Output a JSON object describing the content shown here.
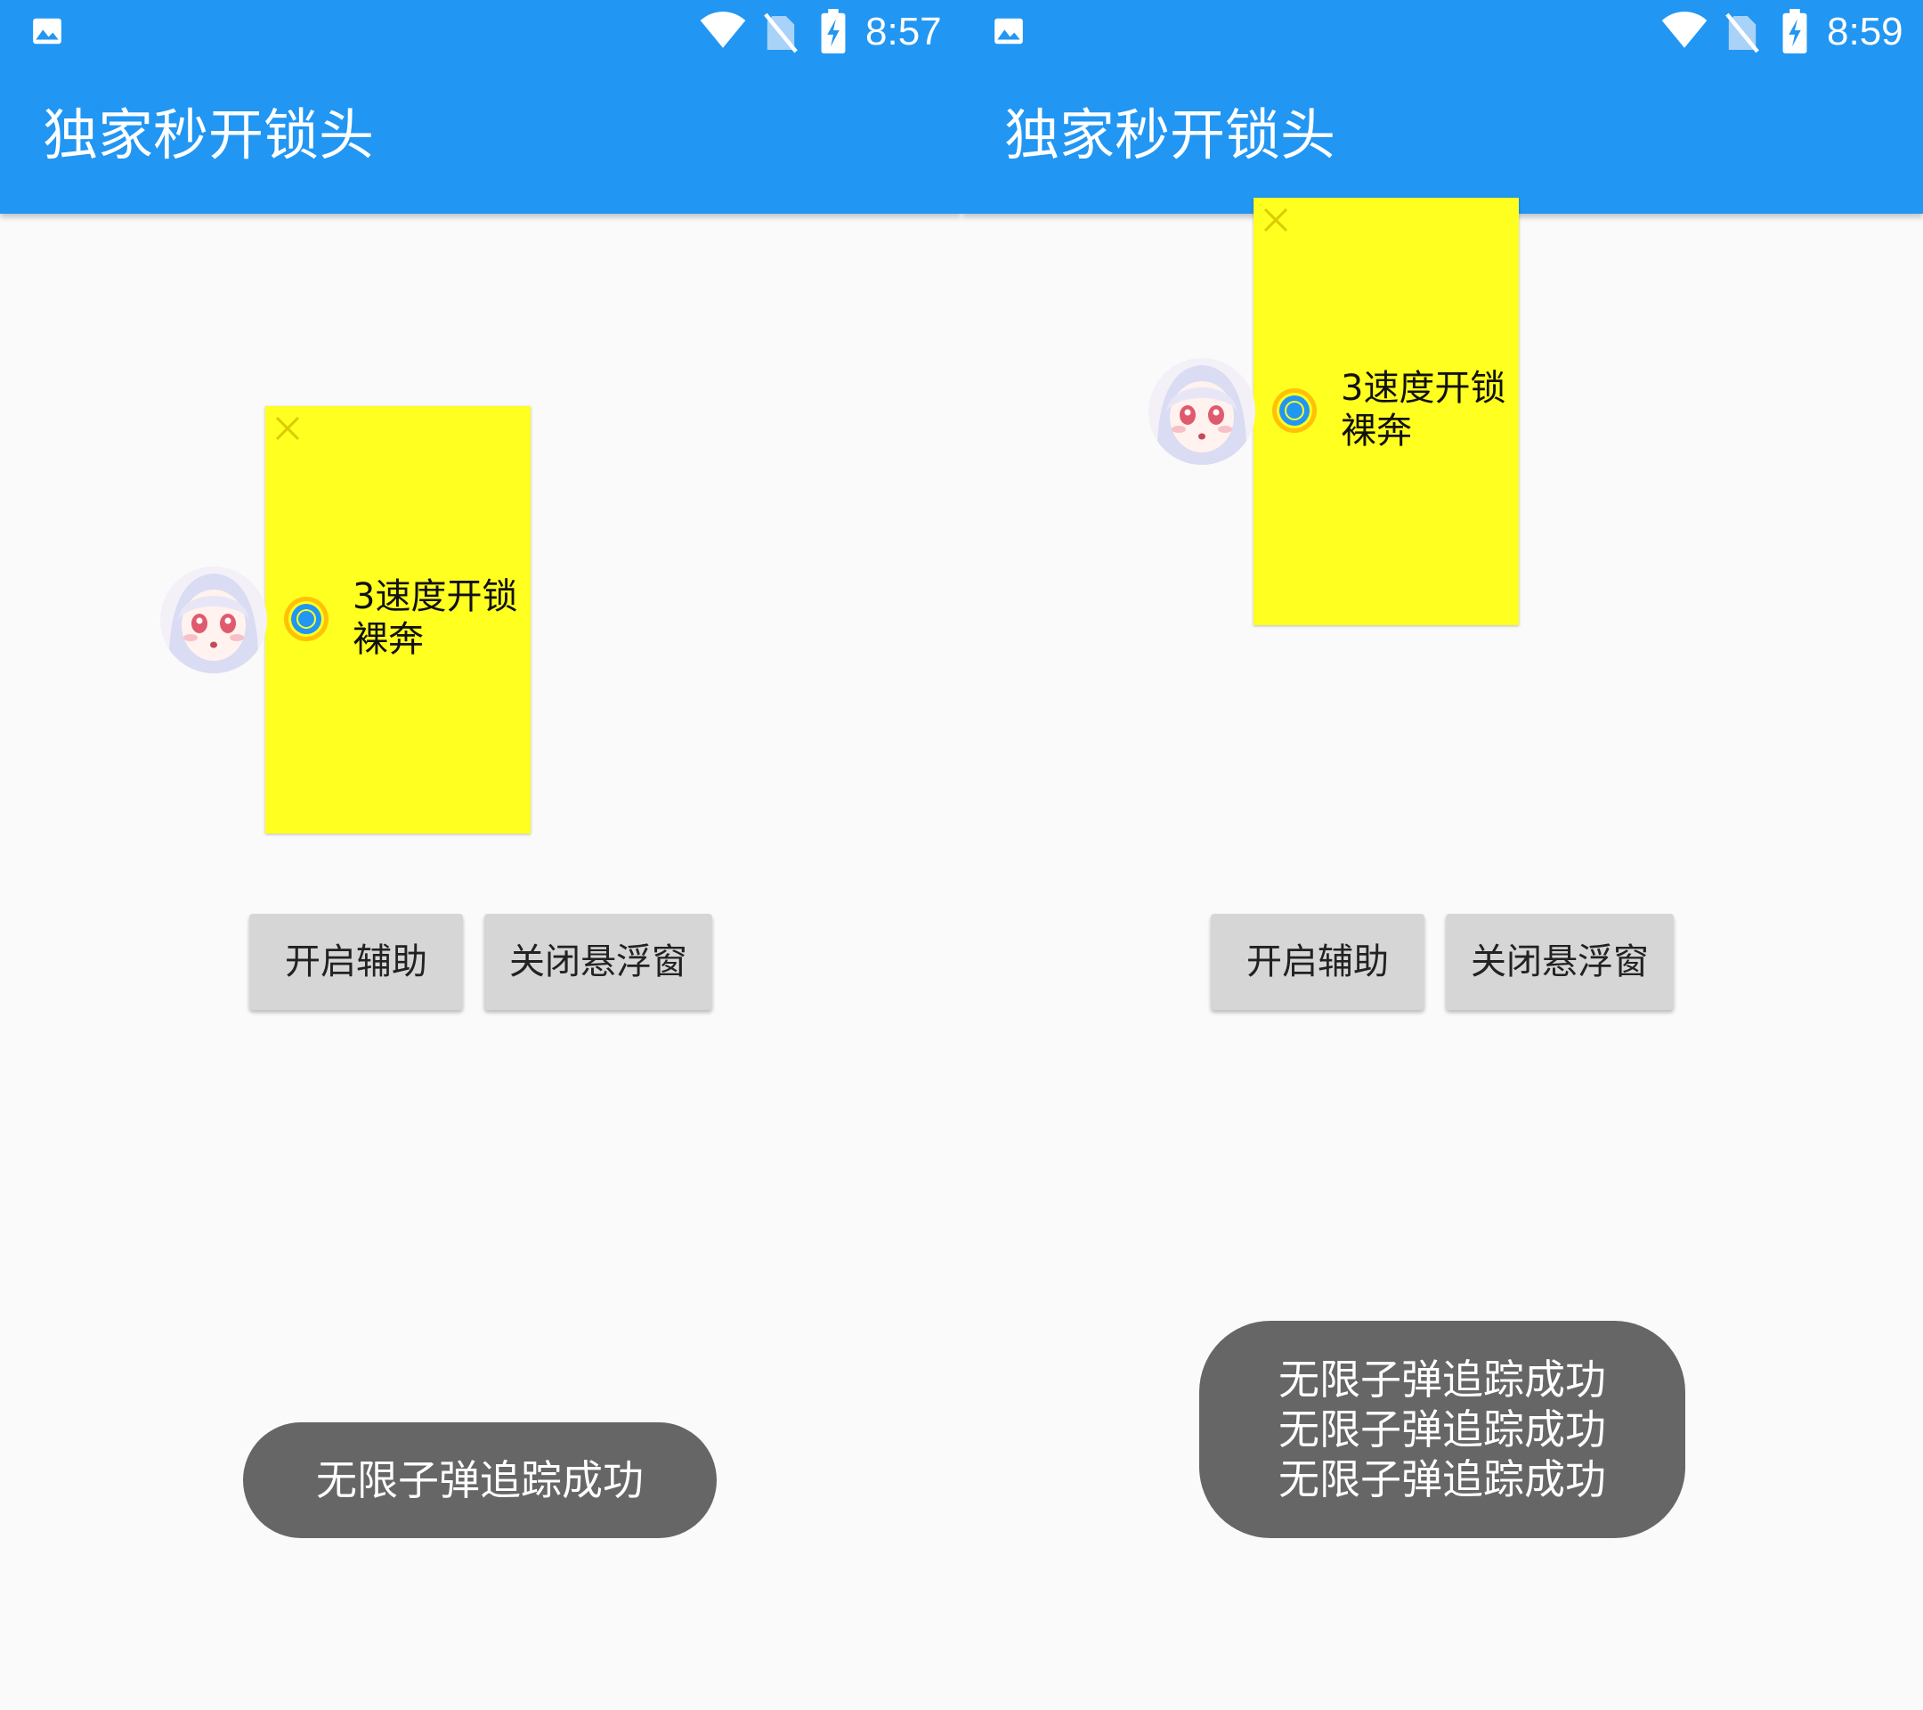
{
  "colors": {
    "app_bar": "#2196f3",
    "background": "#fafafa",
    "floating_panel": "#ffff20",
    "radio_accent": "#2196f3",
    "radio_ring": "#ffc107",
    "button": "#d6d6d6",
    "toast": "#666666"
  },
  "left": {
    "status": {
      "time": "8:57",
      "icons": [
        "gallery-icon",
        "wifi-icon",
        "no-sim-icon",
        "battery-charging-icon"
      ]
    },
    "app_title": "独家秒开锁头",
    "floating_window": {
      "close_icon": "close-icon",
      "radio_icon": "radio-selected-icon",
      "option_label": "3速度开锁\n裸奔"
    },
    "buttons": {
      "open_assist": "开启辅助",
      "close_float": "关闭悬浮窗"
    },
    "toast": [
      "无限子弹追踪成功"
    ]
  },
  "right": {
    "status": {
      "time": "8:59",
      "icons": [
        "gallery-icon",
        "wifi-icon",
        "no-sim-icon",
        "battery-charging-icon"
      ]
    },
    "app_title": "独家秒开锁头",
    "floating_window": {
      "close_icon": "close-icon",
      "radio_icon": "radio-selected-icon",
      "option_label": "3速度开锁\n裸奔"
    },
    "buttons": {
      "open_assist": "开启辅助",
      "close_float": "关闭悬浮窗"
    },
    "toast": [
      "无限子弹追踪成功",
      "无限子弹追踪成功",
      "无限子弹追踪成功"
    ]
  }
}
